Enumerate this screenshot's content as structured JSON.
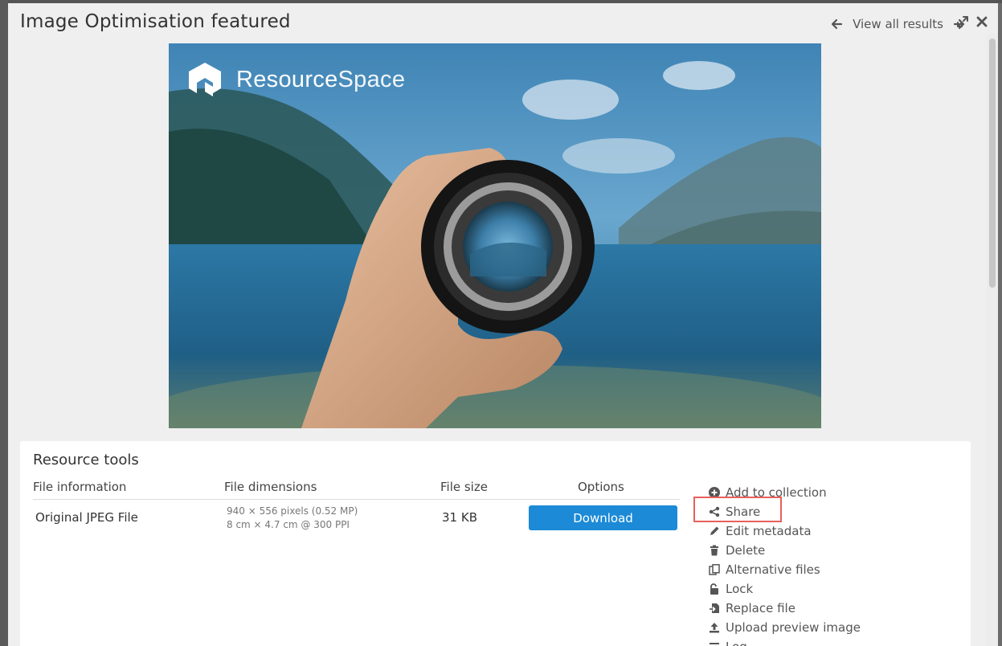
{
  "modal": {
    "title": "Image Optimisation featured",
    "nav": {
      "view_all_label": "View all results",
      "prev_icon": "arrow-left-icon",
      "next_icon": "arrow-right-icon",
      "expand_icon": "expand-icon",
      "close_icon": "close-icon"
    }
  },
  "preview": {
    "brand_part1": "Resource",
    "brand_part2": "Space",
    "brand_logo": "resourcespace-logo"
  },
  "tools": {
    "title": "Resource tools",
    "columns": [
      "File information",
      "File dimensions",
      "File size",
      "Options"
    ],
    "rows": [
      {
        "file_info": "Original JPEG File",
        "dimensions_line1": "940 × 556 pixels (0.52 MP)",
        "dimensions_line2": "8 cm × 4.7 cm @ 300 PPI",
        "file_size": "31 KB",
        "download_label": "Download"
      }
    ],
    "actions": [
      {
        "label": "Add to collection",
        "icon": "plus-circle-icon"
      },
      {
        "label": "Share",
        "icon": "share-icon"
      },
      {
        "label": "Edit metadata",
        "icon": "pencil-icon"
      },
      {
        "label": "Delete",
        "icon": "trash-icon"
      },
      {
        "label": "Alternative files",
        "icon": "copy-icon"
      },
      {
        "label": "Lock",
        "icon": "unlock-icon"
      },
      {
        "label": "Replace file",
        "icon": "replace-file-icon"
      },
      {
        "label": "Upload preview image",
        "icon": "upload-icon"
      },
      {
        "label": "Log",
        "icon": "list-icon"
      }
    ]
  },
  "colors": {
    "accent": "#1c8ad6",
    "highlight": "#e8605c"
  }
}
